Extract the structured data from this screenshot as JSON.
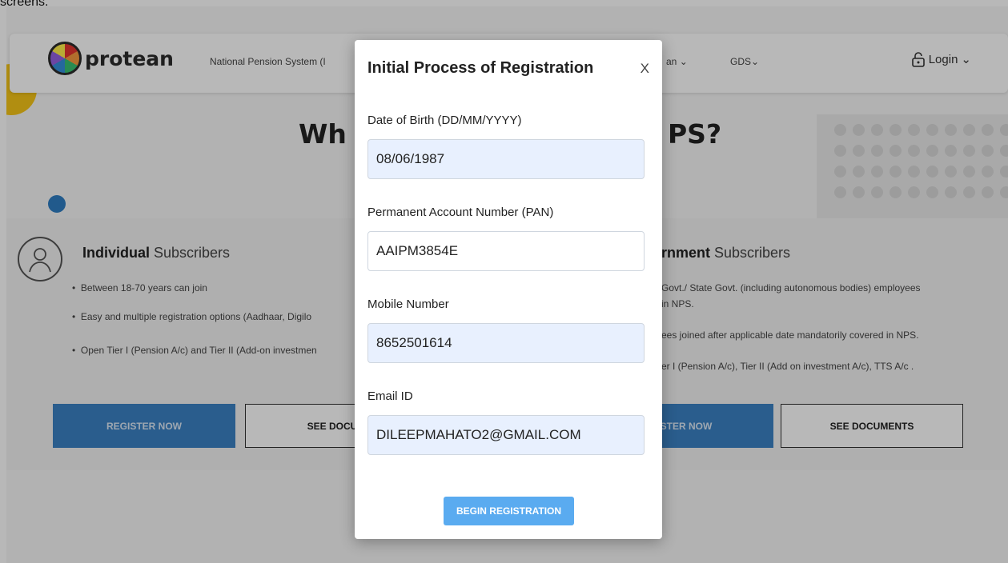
{
  "caption": "screens.",
  "header": {
    "logo_text": "protean",
    "nav_items": [
      "National Pension System (I",
      "an",
      "GDS"
    ],
    "login_label": "Login"
  },
  "background": {
    "heading_left": "Wh",
    "heading_right": "PS?",
    "individual": {
      "title_bold": "Individual",
      "title_rest": " Subscribers",
      "bullets": [
        "Between 18-70 years can join",
        "Easy and multiple registration options (Aadhaar, Digilo",
        "Open Tier I (Pension A/c) and Tier II (Add-on investmen"
      ],
      "register_label": "REGISTER NOW",
      "documents_label": "SEE DOCUM"
    },
    "government": {
      "title_bold": "rnment",
      "title_rest": " Subscribers",
      "bullets": [
        "Govt./ State Govt. (including autonomous bodies) employees",
        "in NPS.",
        "ees joined after applicable date mandatorily covered in NPS.",
        "er I (Pension A/c), Tier II (Add on investment A/c), TTS A/c ."
      ],
      "register_label": "STER NOW",
      "documents_label": "SEE DOCUMENTS"
    }
  },
  "modal": {
    "title": "Initial Process of Registration",
    "close": "X",
    "fields": [
      {
        "label": "Date of Birth (DD/MM/YYYY)",
        "value": "08/06/1987"
      },
      {
        "label": "Permanent Account Number (PAN)",
        "value": "AAIPM3854E"
      },
      {
        "label": "Mobile Number",
        "value": "8652501614"
      },
      {
        "label": "Email ID",
        "value": "DILEEPMAHATO2@GMAIL.COM"
      }
    ],
    "submit_label": "BEGIN REGISTRATION"
  }
}
